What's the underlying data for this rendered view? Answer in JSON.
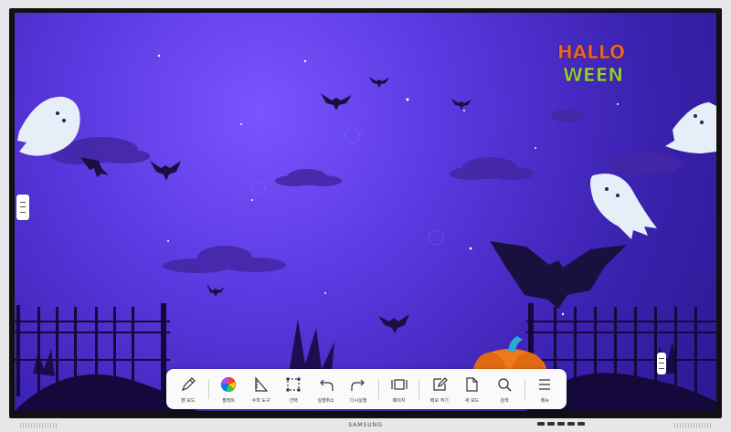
{
  "brand": {
    "name": "SAMSUNG"
  },
  "logo": {
    "line1": "HALLO",
    "line2": "WEEN"
  },
  "toolbar": {
    "items": [
      {
        "id": "pen-mode",
        "label": "펜 모드",
        "icon": "pen-icon"
      },
      {
        "id": "palette",
        "label": "팔레트",
        "icon": "palette-icon"
      },
      {
        "id": "math-tools",
        "label": "수학 도구",
        "icon": "ruler-icon"
      },
      {
        "id": "select",
        "label": "선택",
        "icon": "select-icon"
      },
      {
        "id": "undo",
        "label": "실행취소",
        "icon": "undo-icon"
      },
      {
        "id": "redo",
        "label": "다시실행",
        "icon": "redo-icon"
      },
      {
        "id": "page",
        "label": "페이지",
        "icon": "page-icon"
      },
      {
        "id": "memo",
        "label": "메모 켜기",
        "icon": "memo-icon"
      },
      {
        "id": "new-board",
        "label": "새 보드",
        "icon": "document-icon"
      },
      {
        "id": "search",
        "label": "검색",
        "icon": "search-icon"
      },
      {
        "id": "menu",
        "label": "메뉴",
        "icon": "menu-icon"
      }
    ]
  },
  "colors": {
    "sky_top": "#7a55ff",
    "sky_bottom": "#2a1990",
    "ground": "#1e1050",
    "pumpkin": "#f07a1a",
    "pumpkin_stem": "#2aa9d8"
  }
}
